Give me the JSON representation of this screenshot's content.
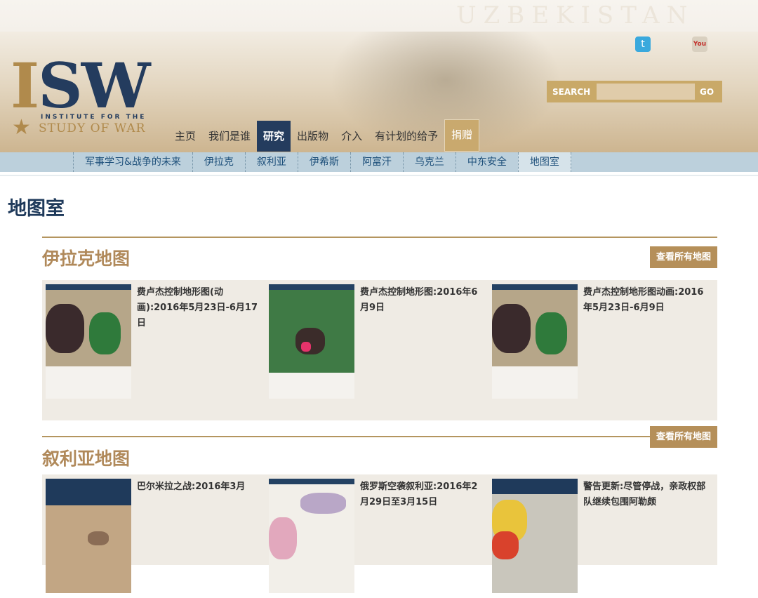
{
  "header": {
    "logo": {
      "isw": "ISW",
      "institute": "INSTITUTE FOR THE",
      "study": "STUDY OF WAR"
    },
    "social": [
      {
        "icon": "twitter-icon"
      },
      {
        "icon": "youtube-icon",
        "glyph": "You"
      }
    ],
    "search": {
      "label": "SEARCH",
      "placeholder": "",
      "go": "GO"
    },
    "watermark": "UZBEKISTAN"
  },
  "main_nav": [
    {
      "label": "主页",
      "active": false
    },
    {
      "label": "我们是谁",
      "active": false
    },
    {
      "label": "研究",
      "active": true
    },
    {
      "label": "出版物",
      "active": false
    },
    {
      "label": "介入",
      "active": false
    },
    {
      "label": "有计划的给予",
      "active": false
    },
    {
      "label": "捐赠",
      "active": false,
      "donate": true
    }
  ],
  "sub_nav": [
    {
      "label": "军事学习&战争的未来",
      "active": false
    },
    {
      "label": "伊拉克",
      "active": false
    },
    {
      "label": "叙利亚",
      "active": false
    },
    {
      "label": "伊希斯",
      "active": false
    },
    {
      "label": "阿富汗",
      "active": false
    },
    {
      "label": "乌克兰",
      "active": false
    },
    {
      "label": "中东安全",
      "active": false
    },
    {
      "label": "地图室",
      "active": true
    }
  ],
  "page": {
    "title": "地图室"
  },
  "sections": [
    {
      "title": "伊拉克地图",
      "view_all": "查看所有地图",
      "cards": [
        {
          "title": "费卢杰控制地形图(动画):2016年5月23日-6月17日"
        },
        {
          "title": "费卢杰控制地形图:2016年6月9日"
        },
        {
          "title": "费卢杰控制地形图动画:2016年5月23日-6月9日"
        }
      ]
    },
    {
      "title": "叙利亚地图",
      "view_all": "查看所有地图",
      "cards": [
        {
          "title": "巴尔米拉之战:2016年3月"
        },
        {
          "title": "俄罗斯空袭叙利亚:2016年2月29日至3月15日"
        },
        {
          "title": "警告更新:尽管停战，亲政权部队继续包围阿勒颇"
        }
      ]
    }
  ],
  "colors": {
    "navy": "#243c5e",
    "gold": "#b58f59",
    "subnav_bg": "#bcd0dc",
    "panel_bg": "#efebe4"
  }
}
